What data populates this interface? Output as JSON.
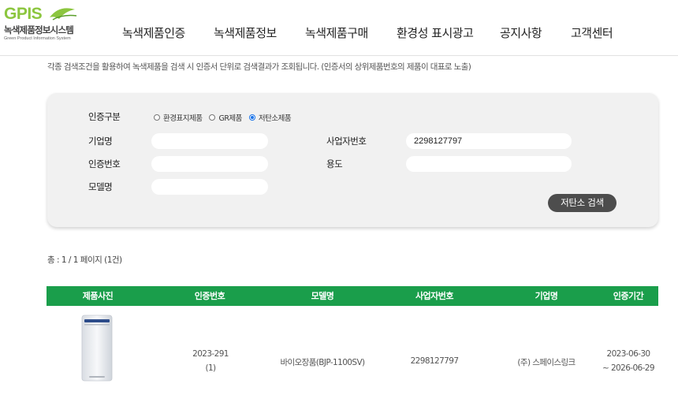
{
  "logo": {
    "text": "GPIS",
    "kor": "녹색제품정보시스템",
    "eng": "Green Product Information System"
  },
  "nav": [
    {
      "label": "녹색제품인증"
    },
    {
      "label": "녹색제품정보"
    },
    {
      "label": "녹색제품구매"
    },
    {
      "label": "환경성 표시광고"
    },
    {
      "label": "공지사항"
    },
    {
      "label": "고객센터"
    }
  ],
  "description": "각종 검색조건을 활용하여 녹색제품을 검색 시 인증서 단위로 검색결과가 조회됩니다. (인증서의 상위제품번호의 제품이 대표로 노출)",
  "search": {
    "cert_type_label": "인증구분",
    "options": [
      "환경표지제품",
      "GR제품",
      "저탄소제품"
    ],
    "selected": "저탄소제품",
    "company_label": "기업명",
    "company_value": "",
    "bizno_label": "사업자번호",
    "bizno_value": "2298127797",
    "certno_label": "인증번호",
    "certno_value": "",
    "usage_label": "용도",
    "usage_value": "",
    "model_label": "모델명",
    "model_value": "",
    "button_label": "저탄소 검색"
  },
  "total_text": "총 : 1 / 1 페이지 (1건)",
  "table": {
    "headers": [
      "제품사진",
      "인증번호",
      "모델명",
      "사업자번호",
      "기업명",
      "인증기간"
    ],
    "rows": [
      {
        "cert_no": "2023-291",
        "cert_sub": "(1)",
        "model": "바이오장품(BJP-1100SV)",
        "biz_no": "2298127797",
        "company": "(주) 스페이스링크",
        "period_start": "2023-06-30",
        "period_end": "~ 2026-06-29"
      }
    ]
  },
  "colors": {
    "brand_green": "#8cc63f",
    "table_header": "#1a9e4b",
    "button": "#4d4d4d"
  }
}
